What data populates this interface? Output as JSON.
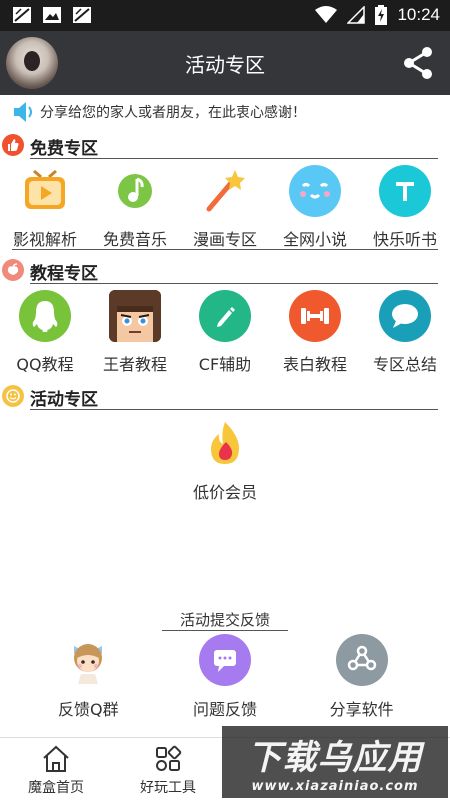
{
  "status_bar": {
    "time": "10:24"
  },
  "header": {
    "title": "活动专区"
  },
  "notice": {
    "text": "分享给您的家人或者朋友，在此衷心感谢！"
  },
  "sections": [
    {
      "title": "免费专区",
      "icon": "thumbs-up-icon",
      "color": "#f0512e",
      "items": [
        {
          "label": "影视解析",
          "icon": "tv-icon",
          "color": "#f5a623"
        },
        {
          "label": "免费音乐",
          "icon": "music-note-icon",
          "color": "#7cc545"
        },
        {
          "label": "漫画专区",
          "icon": "magic-wand-icon",
          "color": "#f26b3a"
        },
        {
          "label": "全网小说",
          "icon": "smiley-face-icon",
          "color": "#5ac8f5"
        },
        {
          "label": "快乐听书",
          "icon": "letter-t-icon",
          "color": "#1bc8d8"
        }
      ]
    },
    {
      "title": "教程专区",
      "icon": "peach-icon",
      "color": "#f08a7a",
      "items": [
        {
          "label": "QQ教程",
          "icon": "qq-penguin-icon",
          "color": "#78c33a"
        },
        {
          "label": "王者教程",
          "icon": "hero-portrait-icon",
          "color": "#8b5a3c"
        },
        {
          "label": "CF辅助",
          "icon": "pencil-icon",
          "color": "#23b686"
        },
        {
          "label": "表白教程",
          "icon": "dumbbell-icon",
          "color": "#f0582e"
        },
        {
          "label": "专区总结",
          "icon": "speech-bubble-icon",
          "color": "#1a9fb8"
        }
      ]
    },
    {
      "title": "活动专区",
      "icon": "smile-icon",
      "color": "#f5c242",
      "items": [
        {
          "label": "低价会员",
          "icon": "flame-icon",
          "color": "#f5c242"
        }
      ]
    }
  ],
  "feedback": {
    "title": "活动提交反馈",
    "items": [
      {
        "label": "反馈Q群",
        "icon": "cartoon-girl-icon"
      },
      {
        "label": "问题反馈",
        "icon": "chat-icon",
        "color": "#a77bf0"
      },
      {
        "label": "分享软件",
        "icon": "share-nodes-icon",
        "color": "#8e9aa2"
      }
    ]
  },
  "bottom_nav": [
    {
      "label": "魔盒首页",
      "icon": "home-icon"
    },
    {
      "label": "好玩工具",
      "icon": "apps-icon"
    }
  ],
  "watermark": {
    "big": "下载乌应用",
    "small": "www.xiazainiao.com"
  }
}
